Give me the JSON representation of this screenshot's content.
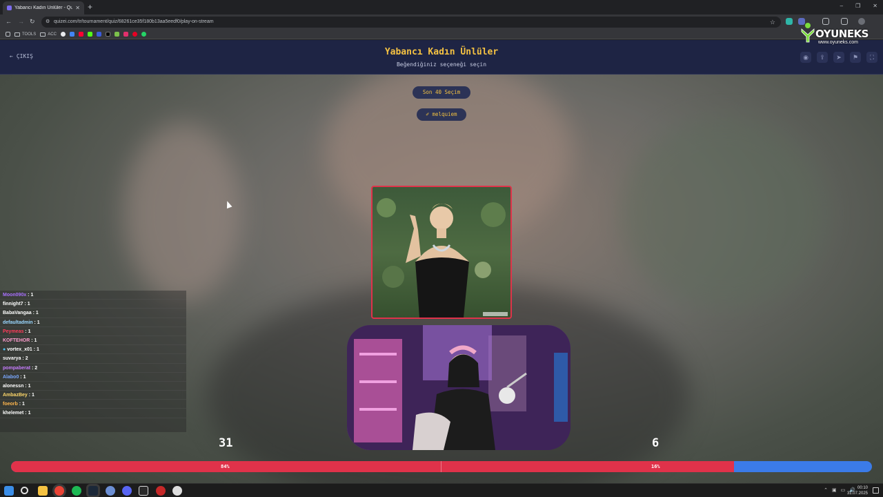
{
  "browser": {
    "tab_title": "Yabancı Kadın Ünlüler - Quizei",
    "tab_close": "✕",
    "new_tab": "+",
    "url": "quizei.com/tr/tournament/quiz/68261ce35f180b13aa5eedf0/play-on-stream",
    "bookmarks": [
      {
        "label": "TOOLS",
        "icon": "folder-icon"
      },
      {
        "label": "ACC",
        "icon": "folder-icon"
      }
    ],
    "window_controls": [
      "–",
      "❐",
      "✕"
    ]
  },
  "brand": {
    "name": "OYUNEKS",
    "url": "www.oyuneks.com"
  },
  "header": {
    "exit_label": "ÇIKIŞ",
    "title": "Yabancı Kadın Ünlüler",
    "subtitle": "Beğendiğiniz seçeneği seçin",
    "icons": [
      "eye-icon",
      "share-icon",
      "send-icon",
      "flag-icon",
      "fullscreen-icon"
    ]
  },
  "stage": {
    "last_choices_label": "Son 40 Seçim",
    "user_label": "melquiem"
  },
  "chat": {
    "messages": [
      {
        "user": "Moon090x",
        "text": " : 1",
        "color": "#a970ff"
      },
      {
        "user": "finnight7",
        "text": " : 1",
        "color": "#ffffff"
      },
      {
        "user": "BabaVangaa",
        "text": " : 1",
        "color": "#ffffff"
      },
      {
        "user": "defaultadmin",
        "text": " : 1",
        "color": "#9ad7ff"
      },
      {
        "user": "Peymeas",
        "text": " : 1",
        "color": "#ff3c5a"
      },
      {
        "user": "KOFTEHOR",
        "text": " : 1",
        "color": "#ff9ecf"
      },
      {
        "user": "vortex_x01",
        "text": " : 1",
        "color": "#ffffff"
      },
      {
        "user": "suvarya",
        "text": " : 2",
        "color": "#ffffff"
      },
      {
        "user": "pompaberat",
        "text": " : 2",
        "color": "#c77dff"
      },
      {
        "user": "Alabo0",
        "text": " : 1",
        "color": "#7aa8ff"
      },
      {
        "user": "alonessn",
        "text": " : 1",
        "color": "#ffffff"
      },
      {
        "user": "AmbazBey",
        "text": " : 1",
        "color": "#ffd86b"
      },
      {
        "user": "foeorb",
        "text": " : 1",
        "color": "#ffb74d"
      },
      {
        "user": "khelemet",
        "text": " : 1",
        "color": "#ffffff"
      }
    ]
  },
  "votes": {
    "left_count": "31",
    "right_count": "6",
    "left_pct_label": "84%",
    "right_pct_label": "16%",
    "left_fraction": 0.84,
    "left_color": "#e0324a",
    "right_color": "#3b7be8"
  },
  "taskbar": {
    "time": "00:10",
    "date": "31.07.2025"
  }
}
